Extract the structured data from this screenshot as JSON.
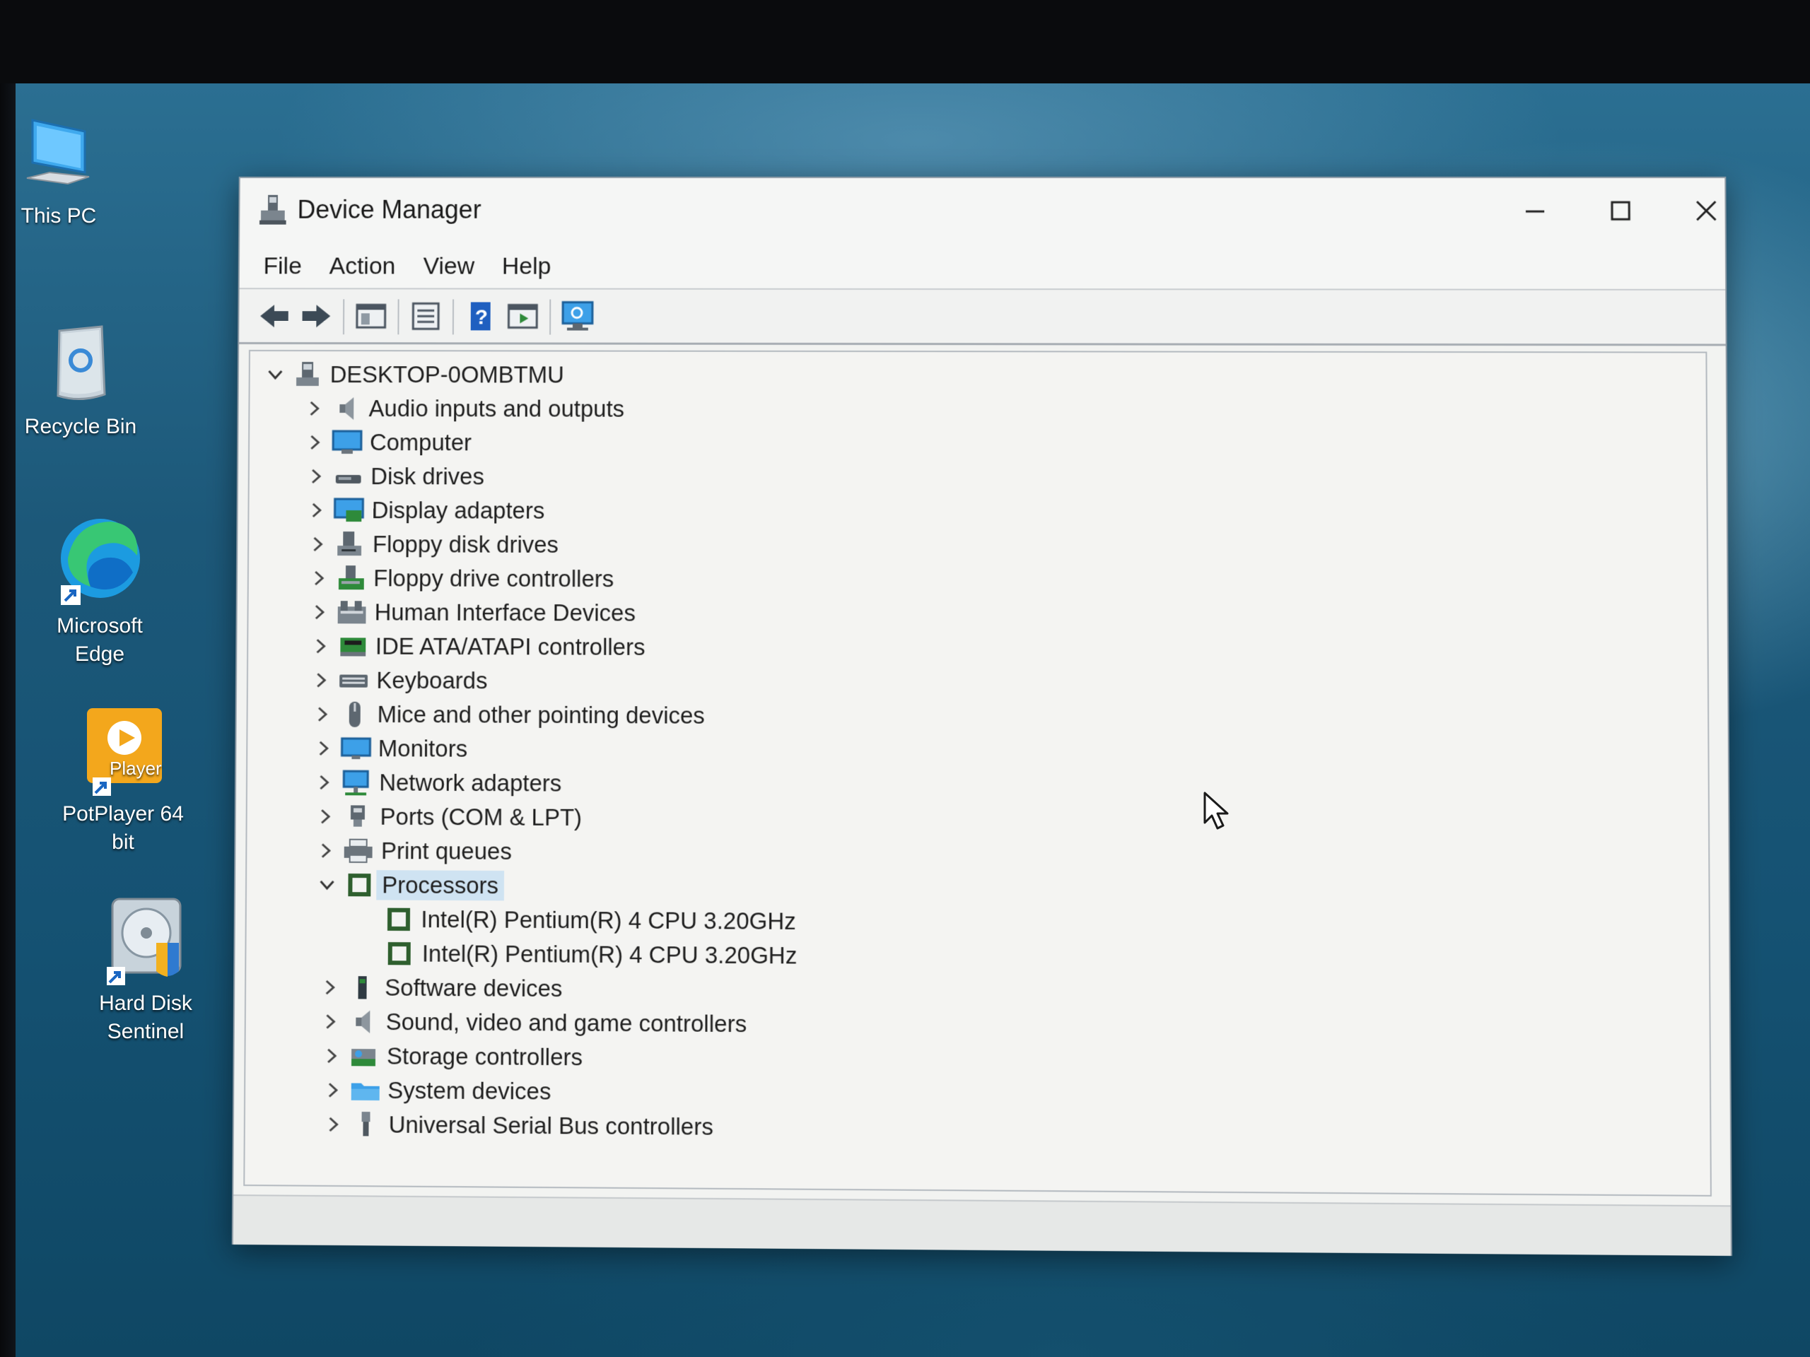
{
  "desktop": {
    "icons": [
      {
        "label": "This PC",
        "icon": "monitor-icon"
      },
      {
        "label": "Recycle Bin",
        "icon": "recycle-bin-icon"
      },
      {
        "label": "Microsoft Edge",
        "icon": "edge-icon"
      },
      {
        "label": "PotPlayer 64 bit",
        "icon": "potplayer-icon",
        "badge": "Player"
      },
      {
        "label": "Hard Disk Sentinel",
        "icon": "hard-disk-icon"
      }
    ]
  },
  "window": {
    "title": "Device Manager",
    "controls": {
      "minimize": "—",
      "maximize": "☐",
      "close": "✕"
    },
    "menu": [
      "File",
      "Action",
      "View",
      "Help"
    ],
    "toolbar": [
      "back-icon",
      "forward-icon",
      "properties-panel-icon",
      "details-icon",
      "help-icon",
      "run-icon",
      "monitor-scan-icon"
    ],
    "tree": {
      "root": "DESKTOP-0OMBTMU",
      "items": [
        {
          "label": "Audio inputs and outputs",
          "icon": "speaker-icon",
          "expanded": false
        },
        {
          "label": "Computer",
          "icon": "computer-icon",
          "expanded": false
        },
        {
          "label": "Disk drives",
          "icon": "disk-drive-icon",
          "expanded": false
        },
        {
          "label": "Display adapters",
          "icon": "display-adapter-icon",
          "expanded": false
        },
        {
          "label": "Floppy disk drives",
          "icon": "floppy-drive-icon",
          "expanded": false
        },
        {
          "label": "Floppy drive controllers",
          "icon": "floppy-controller-icon",
          "expanded": false
        },
        {
          "label": "Human Interface Devices",
          "icon": "hid-icon",
          "expanded": false
        },
        {
          "label": "IDE ATA/ATAPI controllers",
          "icon": "ide-controller-icon",
          "expanded": false
        },
        {
          "label": "Keyboards",
          "icon": "keyboard-icon",
          "expanded": false
        },
        {
          "label": "Mice and other pointing devices",
          "icon": "mouse-icon",
          "expanded": false
        },
        {
          "label": "Monitors",
          "icon": "monitor-icon",
          "expanded": false
        },
        {
          "label": "Network adapters",
          "icon": "network-adapter-icon",
          "expanded": false
        },
        {
          "label": "Ports (COM & LPT)",
          "icon": "port-icon",
          "expanded": false
        },
        {
          "label": "Print queues",
          "icon": "printer-icon",
          "expanded": false
        },
        {
          "label": "Processors",
          "icon": "processor-icon",
          "expanded": true,
          "selected": true,
          "children": [
            {
              "label": "Intel(R) Pentium(R) 4 CPU 3.20GHz",
              "icon": "processor-icon"
            },
            {
              "label": "Intel(R) Pentium(R) 4 CPU 3.20GHz",
              "icon": "processor-icon"
            }
          ]
        },
        {
          "label": "Software devices",
          "icon": "software-device-icon",
          "expanded": false
        },
        {
          "label": "Sound, video and game controllers",
          "icon": "speaker-icon",
          "expanded": false
        },
        {
          "label": "Storage controllers",
          "icon": "storage-controller-icon",
          "expanded": false
        },
        {
          "label": "System devices",
          "icon": "system-folder-icon",
          "expanded": false
        },
        {
          "label": "Universal Serial Bus controllers",
          "icon": "usb-icon",
          "expanded": false
        }
      ]
    }
  },
  "colors": {
    "accent": "#1f76c6",
    "selection": "#cfe3f2",
    "processor": "#2e5f2e"
  }
}
